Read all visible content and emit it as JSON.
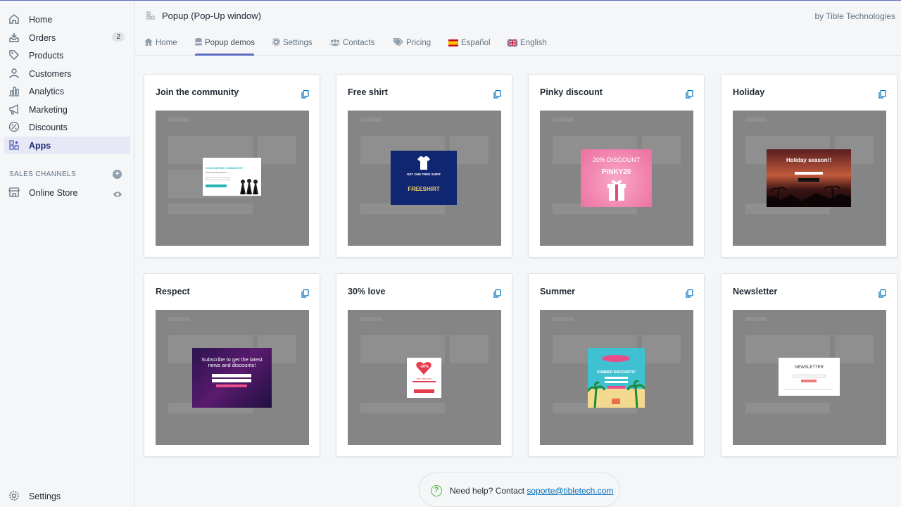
{
  "sidebar": {
    "items": [
      {
        "label": "Home",
        "icon": "home-icon"
      },
      {
        "label": "Orders",
        "icon": "orders-icon",
        "badge": "2"
      },
      {
        "label": "Products",
        "icon": "tag-icon"
      },
      {
        "label": "Customers",
        "icon": "person-icon"
      },
      {
        "label": "Analytics",
        "icon": "bar-chart-icon"
      },
      {
        "label": "Marketing",
        "icon": "megaphone-icon"
      },
      {
        "label": "Discounts",
        "icon": "discount-icon"
      },
      {
        "label": "Apps",
        "icon": "apps-icon",
        "active": true
      }
    ],
    "sales_channels_title": "SALES CHANNELS",
    "online_store": "Online Store",
    "settings": "Settings"
  },
  "header": {
    "title": "Popup (Pop-Up window)",
    "by": "by Tible Technologies",
    "tabs": [
      {
        "label": "Home",
        "icon": "home-icon"
      },
      {
        "label": "Popup demos",
        "icon": "database-icon",
        "active": true
      },
      {
        "label": "Settings",
        "icon": "gear-icon"
      },
      {
        "label": "Contacts",
        "icon": "users-icon"
      },
      {
        "label": "Pricing",
        "icon": "tags-icon"
      },
      {
        "label": "Español",
        "icon": "spain-flag-icon"
      },
      {
        "label": "English",
        "icon": "uk-flag-icon"
      }
    ]
  },
  "cards": [
    {
      "title": "Join the community",
      "popup": {
        "heading": "JOIN OUR BIG COMMUNITY",
        "button": "Submit"
      }
    },
    {
      "title": "Free shirt",
      "popup": {
        "heading": "GET ONE FREE SHIRT",
        "code": "FREESHIRT"
      }
    },
    {
      "title": "Pinky discount",
      "popup": {
        "heading": "20% DISCOUNT",
        "code": "PINKY20"
      }
    },
    {
      "title": "Holiday",
      "popup": {
        "heading": "Holiday season!!"
      }
    },
    {
      "title": "Respect",
      "popup": {
        "heading": "Subscribe to get the latest news and discounts!"
      }
    },
    {
      "title": "30% love",
      "popup": {
        "heading": "-30%",
        "sub": "We love you"
      }
    },
    {
      "title": "Summer",
      "popup": {
        "heading": "SUMMER DISCOUNTS!"
      }
    },
    {
      "title": "Newsletter",
      "popup": {
        "heading": "NEWSLETTER"
      }
    }
  ],
  "help": {
    "text": "Need help? Contact ",
    "email": "soporte@tibletech.com"
  },
  "colors": {
    "accent": "#5c6ac4",
    "link": "#006fbb",
    "help": "#50b83c"
  }
}
